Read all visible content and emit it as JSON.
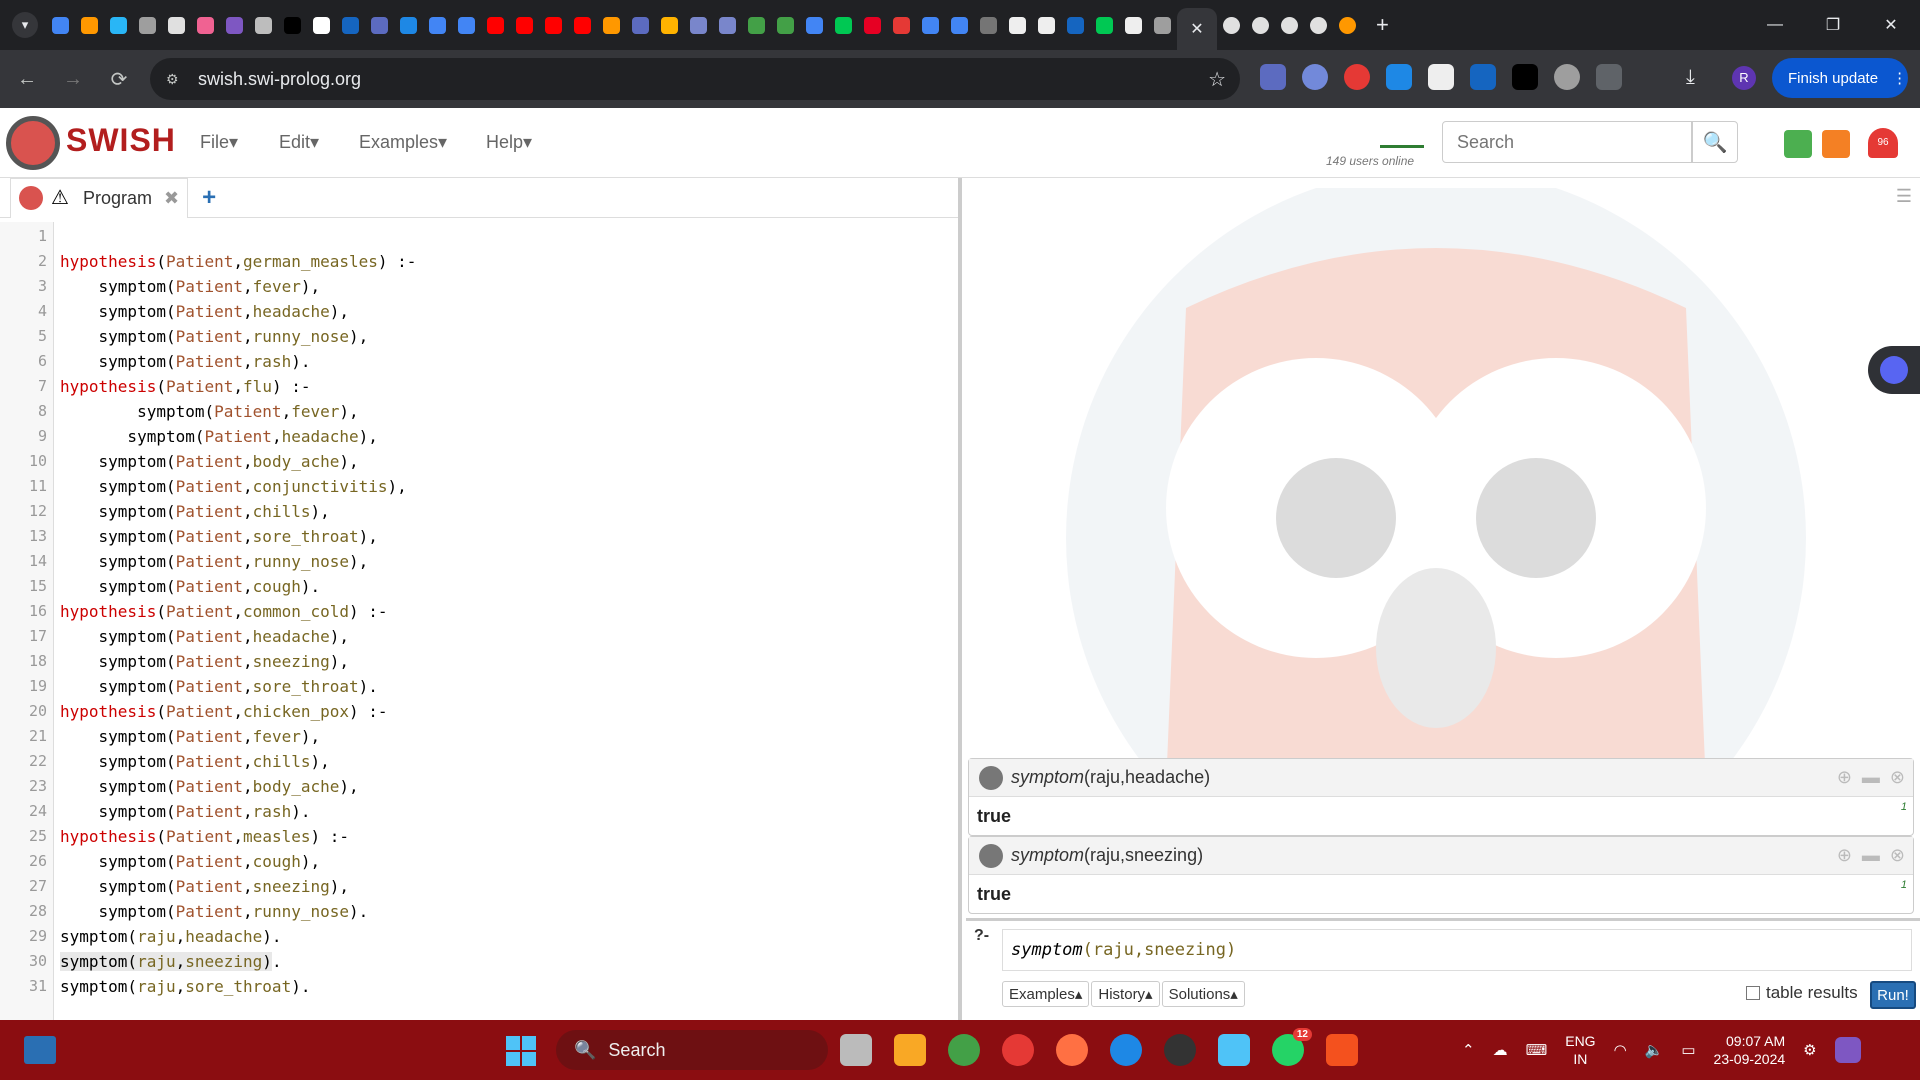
{
  "browser": {
    "tab_list_icon": "chevron-down-icon",
    "active_tab_close": "✕",
    "new_tab": "+",
    "url": "swish.swi-prolog.org",
    "finish_update_label": "Finish update",
    "profile_initial": "R"
  },
  "swish": {
    "title": "SWISH",
    "menus": [
      "File▾",
      "Edit▾",
      "Examples▾",
      "Help▾"
    ],
    "users_online": "149 users online",
    "search_placeholder": "Search",
    "notification_count": "96"
  },
  "editor": {
    "tab_label": "Program",
    "lines": [
      [],
      [
        [
          "kw",
          "hypothesis"
        ],
        [
          "pc",
          "("
        ],
        [
          "v",
          "Patient"
        ],
        [
          "pc",
          ","
        ],
        [
          "a",
          "german_measles"
        ],
        [
          "pc",
          ") :-"
        ]
      ],
      [
        [
          "pc",
          "    symptom("
        ],
        [
          "v",
          "Patient"
        ],
        [
          "pc",
          ","
        ],
        [
          "a",
          "fever"
        ],
        [
          "pc",
          "),"
        ]
      ],
      [
        [
          "pc",
          "    symptom("
        ],
        [
          "v",
          "Patient"
        ],
        [
          "pc",
          ","
        ],
        [
          "a",
          "headache"
        ],
        [
          "pc",
          "),"
        ]
      ],
      [
        [
          "pc",
          "    symptom("
        ],
        [
          "v",
          "Patient"
        ],
        [
          "pc",
          ","
        ],
        [
          "a",
          "runny_nose"
        ],
        [
          "pc",
          "),"
        ]
      ],
      [
        [
          "pc",
          "    symptom("
        ],
        [
          "v",
          "Patient"
        ],
        [
          "pc",
          ","
        ],
        [
          "a",
          "rash"
        ],
        [
          "pc",
          ")."
        ]
      ],
      [
        [
          "kw",
          "hypothesis"
        ],
        [
          "pc",
          "("
        ],
        [
          "v",
          "Patient"
        ],
        [
          "pc",
          ","
        ],
        [
          "a",
          "flu"
        ],
        [
          "pc",
          ") :-"
        ]
      ],
      [
        [
          "pc",
          "        symptom("
        ],
        [
          "v",
          "Patient"
        ],
        [
          "pc",
          ","
        ],
        [
          "a",
          "fever"
        ],
        [
          "pc",
          "),"
        ]
      ],
      [
        [
          "pc",
          "       symptom("
        ],
        [
          "v",
          "Patient"
        ],
        [
          "pc",
          ","
        ],
        [
          "a",
          "headache"
        ],
        [
          "pc",
          "),"
        ]
      ],
      [
        [
          "pc",
          "    symptom("
        ],
        [
          "v",
          "Patient"
        ],
        [
          "pc",
          ","
        ],
        [
          "a",
          "body_ache"
        ],
        [
          "pc",
          "),"
        ]
      ],
      [
        [
          "pc",
          "    symptom("
        ],
        [
          "v",
          "Patient"
        ],
        [
          "pc",
          ","
        ],
        [
          "a",
          "conjunctivitis"
        ],
        [
          "pc",
          "),"
        ]
      ],
      [
        [
          "pc",
          "    symptom("
        ],
        [
          "v",
          "Patient"
        ],
        [
          "pc",
          ","
        ],
        [
          "a",
          "chills"
        ],
        [
          "pc",
          "),"
        ]
      ],
      [
        [
          "pc",
          "    symptom("
        ],
        [
          "v",
          "Patient"
        ],
        [
          "pc",
          ","
        ],
        [
          "a",
          "sore_throat"
        ],
        [
          "pc",
          "),"
        ]
      ],
      [
        [
          "pc",
          "    symptom("
        ],
        [
          "v",
          "Patient"
        ],
        [
          "pc",
          ","
        ],
        [
          "a",
          "runny_nose"
        ],
        [
          "pc",
          "),"
        ]
      ],
      [
        [
          "pc",
          "    symptom("
        ],
        [
          "v",
          "Patient"
        ],
        [
          "pc",
          ","
        ],
        [
          "a",
          "cough"
        ],
        [
          "pc",
          ")."
        ]
      ],
      [
        [
          "kw",
          "hypothesis"
        ],
        [
          "pc",
          "("
        ],
        [
          "v",
          "Patient"
        ],
        [
          "pc",
          ","
        ],
        [
          "a",
          "common_cold"
        ],
        [
          "pc",
          ") :-"
        ]
      ],
      [
        [
          "pc",
          "    symptom("
        ],
        [
          "v",
          "Patient"
        ],
        [
          "pc",
          ","
        ],
        [
          "a",
          "headache"
        ],
        [
          "pc",
          "),"
        ]
      ],
      [
        [
          "pc",
          "    symptom("
        ],
        [
          "v",
          "Patient"
        ],
        [
          "pc",
          ","
        ],
        [
          "a",
          "sneezing"
        ],
        [
          "pc",
          "),"
        ]
      ],
      [
        [
          "pc",
          "    symptom("
        ],
        [
          "v",
          "Patient"
        ],
        [
          "pc",
          ","
        ],
        [
          "a",
          "sore_throat"
        ],
        [
          "pc",
          ")."
        ]
      ],
      [
        [
          "kw",
          "hypothesis"
        ],
        [
          "pc",
          "("
        ],
        [
          "v",
          "Patient"
        ],
        [
          "pc",
          ","
        ],
        [
          "a",
          "chicken_pox"
        ],
        [
          "pc",
          ") :-"
        ]
      ],
      [
        [
          "pc",
          "    symptom("
        ],
        [
          "v",
          "Patient"
        ],
        [
          "pc",
          ","
        ],
        [
          "a",
          "fever"
        ],
        [
          "pc",
          "),"
        ]
      ],
      [
        [
          "pc",
          "    symptom("
        ],
        [
          "v",
          "Patient"
        ],
        [
          "pc",
          ","
        ],
        [
          "a",
          "chills"
        ],
        [
          "pc",
          "),"
        ]
      ],
      [
        [
          "pc",
          "    symptom("
        ],
        [
          "v",
          "Patient"
        ],
        [
          "pc",
          ","
        ],
        [
          "a",
          "body_ache"
        ],
        [
          "pc",
          "),"
        ]
      ],
      [
        [
          "pc",
          "    symptom("
        ],
        [
          "v",
          "Patient"
        ],
        [
          "pc",
          ","
        ],
        [
          "a",
          "rash"
        ],
        [
          "pc",
          ")."
        ]
      ],
      [
        [
          "kw",
          "hypothesis"
        ],
        [
          "pc",
          "("
        ],
        [
          "v",
          "Patient"
        ],
        [
          "pc",
          ","
        ],
        [
          "a",
          "measles"
        ],
        [
          "pc",
          ") :-"
        ]
      ],
      [
        [
          "pc",
          "    symptom("
        ],
        [
          "v",
          "Patient"
        ],
        [
          "pc",
          ","
        ],
        [
          "a",
          "cough"
        ],
        [
          "pc",
          "),"
        ]
      ],
      [
        [
          "pc",
          "    symptom("
        ],
        [
          "v",
          "Patient"
        ],
        [
          "pc",
          ","
        ],
        [
          "a",
          "sneezing"
        ],
        [
          "pc",
          "),"
        ]
      ],
      [
        [
          "pc",
          "    symptom("
        ],
        [
          "v",
          "Patient"
        ],
        [
          "pc",
          ","
        ],
        [
          "a",
          "runny_nose"
        ],
        [
          "pc",
          ")."
        ]
      ],
      [
        [
          "pc",
          "symptom("
        ],
        [
          "a",
          "raju"
        ],
        [
          "pc",
          ","
        ],
        [
          "a",
          "headache"
        ],
        [
          "pc",
          ")."
        ]
      ],
      [
        [
          "pc",
          "symptom("
        ],
        [
          "a",
          "raju"
        ],
        [
          "pc",
          ","
        ],
        [
          "a",
          "sneezing"
        ],
        [
          "pc",
          ")."
        ]
      ],
      [
        [
          "pc",
          "symptom("
        ],
        [
          "a",
          "raju"
        ],
        [
          "pc",
          ","
        ],
        [
          "a",
          "sore_throat"
        ],
        [
          "pc",
          ")."
        ]
      ]
    ],
    "highlight_line": 30
  },
  "results": {
    "queries": [
      {
        "pred": "symptom",
        "args": "(raju,headache)",
        "answer": "true",
        "count": "1"
      },
      {
        "pred": "symptom",
        "args": "(raju,sneezing)",
        "answer": "true",
        "count": "1"
      }
    ],
    "prompt": "?-",
    "query_pred": "symptom",
    "query_args": "(raju,sneezing)",
    "buttons": [
      "Examples▴",
      "History▴",
      "Solutions▴"
    ],
    "table_results_label": "table results",
    "run_label": "Run!"
  },
  "taskbar": {
    "search_label": "Search",
    "whatsapp_badge": "12",
    "lang_line1": "ENG",
    "lang_line2": "IN",
    "time": "09:07 AM",
    "date": "23-09-2024"
  },
  "colors": {
    "keyword": "#cc0000",
    "variable": "#a0522d",
    "atom": "#776622",
    "taskbar": "#8b0d11",
    "run_button": "#2a6fb3"
  }
}
